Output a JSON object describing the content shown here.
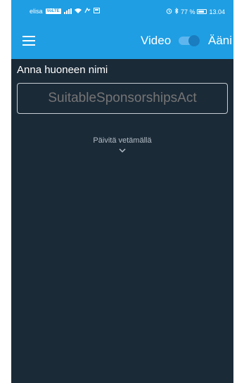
{
  "status_bar": {
    "carrier": "elisa",
    "volte": "VoLTE",
    "battery": "77 %",
    "time": "13.04"
  },
  "app_bar": {
    "menu_icon": "hamburger-menu-icon",
    "video_label": "Video",
    "audio_label": "Ääni",
    "toggle_state": "off"
  },
  "room": {
    "label": "Anna huoneen nimi",
    "placeholder": "SuitableSponsorshipsAct"
  },
  "pull_to_refresh": {
    "label": "Päivitä vetämällä",
    "icon": "chevron-down-icon"
  },
  "colors": {
    "app_bar": "#1f9ee3",
    "background": "#1b2a37",
    "input_border": "#c6cdd3"
  }
}
